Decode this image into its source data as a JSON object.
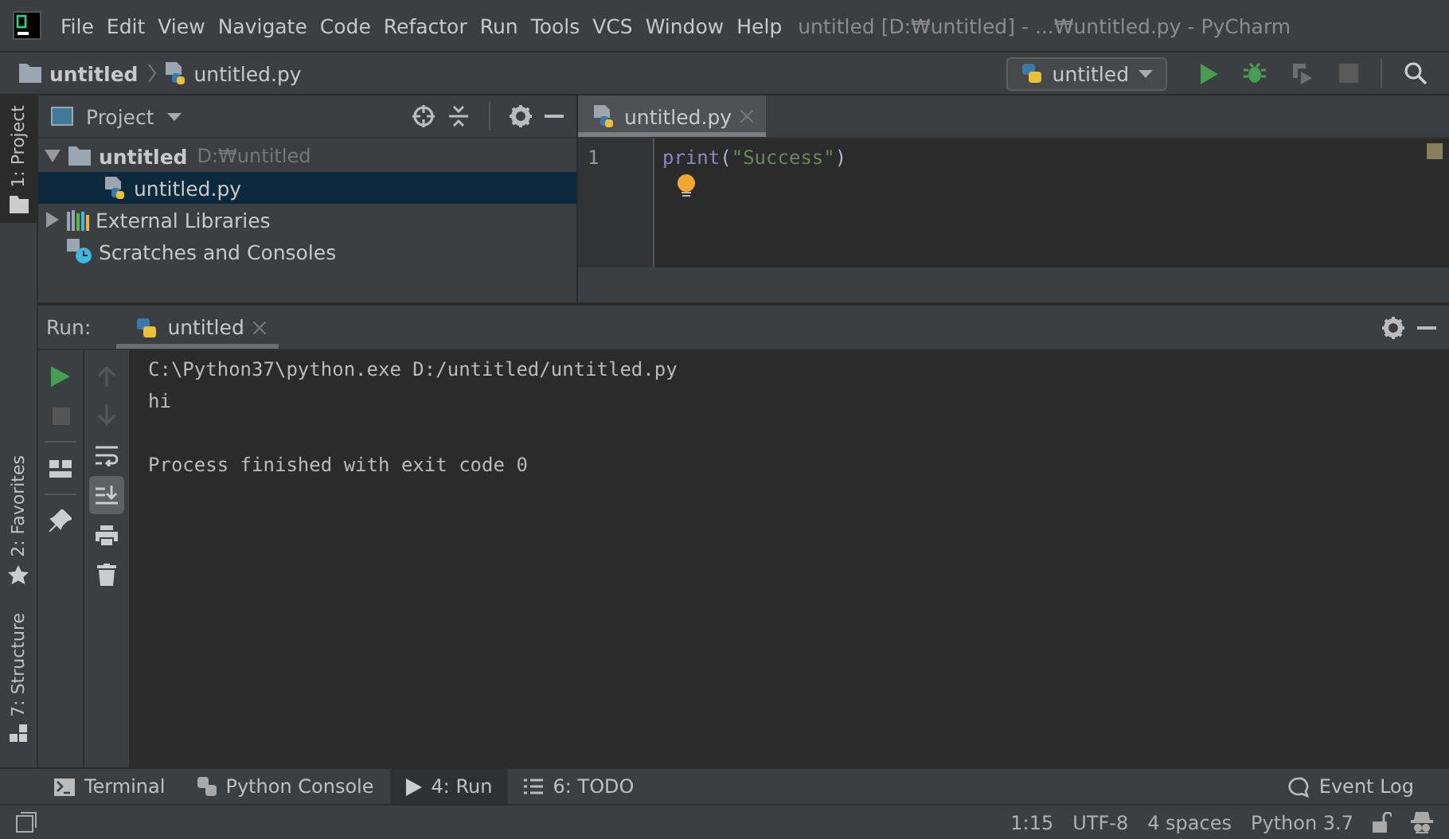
{
  "title_bar": {
    "menu": [
      "File",
      "Edit",
      "View",
      "Navigate",
      "Code",
      "Refactor",
      "Run",
      "Tools",
      "VCS",
      "Window",
      "Help"
    ],
    "window_title": "untitled [D:₩untitled] - ...₩untitled.py - PyCharm"
  },
  "nav_bar": {
    "breadcrumbs": [
      {
        "label": "untitled",
        "kind": "folder"
      },
      {
        "label": "untitled.py",
        "kind": "python"
      }
    ],
    "run_config": "untitled"
  },
  "tool_stripe": [
    {
      "label": "1: Project",
      "kind": "project",
      "selected": true
    },
    {
      "label": "2: Favorites",
      "kind": "favorites",
      "selected": false
    },
    {
      "label": "7: Structure",
      "kind": "structure",
      "selected": false
    }
  ],
  "project_panel": {
    "title": "Project",
    "tree": [
      {
        "name": "untitled",
        "path": "D:₩untitled",
        "kind": "folder",
        "expanded": true,
        "selected": false,
        "children": [
          {
            "name": "untitled.py",
            "kind": "python",
            "selected": true
          }
        ]
      },
      {
        "name": "External Libraries",
        "kind": "libraries",
        "expanded": false,
        "selected": false
      },
      {
        "name": "Scratches and Consoles",
        "kind": "scratches",
        "selected": false
      }
    ]
  },
  "editor": {
    "tabs": [
      {
        "label": "untitled.py",
        "selected": true
      }
    ],
    "lines": [
      {
        "number": "1",
        "tokens": [
          {
            "text": "print",
            "kind": "function"
          },
          {
            "text": "(",
            "kind": "plain"
          },
          {
            "text": "\"Success\"",
            "kind": "string"
          },
          {
            "text": ")",
            "kind": "plain"
          }
        ]
      }
    ]
  },
  "run_panel": {
    "label": "Run:",
    "tabs": [
      {
        "label": "untitled",
        "selected": true
      }
    ],
    "left_toolbar": [
      {
        "kind": "rerun",
        "disabled": false
      },
      {
        "kind": "stop",
        "disabled": true
      },
      {
        "kind": "layout",
        "disabled": false
      },
      {
        "kind": "pin",
        "disabled": false
      }
    ],
    "right_toolbar": [
      {
        "kind": "up",
        "disabled": true,
        "on": false
      },
      {
        "kind": "down",
        "disabled": true,
        "on": false
      },
      {
        "kind": "wrap",
        "disabled": false,
        "on": false
      },
      {
        "kind": "scroll-end",
        "disabled": false,
        "on": true
      },
      {
        "kind": "print",
        "disabled": false,
        "on": false
      },
      {
        "kind": "clear",
        "disabled": false,
        "on": false
      }
    ],
    "output": [
      {
        "text": "C:\\Python37\\python.exe D:/untitled/untitled.py",
        "kind": "command"
      },
      {
        "text": "hi",
        "kind": "stdout"
      },
      {
        "text": "Process finished with exit code 0",
        "kind": "exit"
      }
    ]
  },
  "bottom_tabs": [
    {
      "label": "Terminal",
      "kind": "terminal",
      "selected": false
    },
    {
      "label": "Python Console",
      "kind": "python",
      "selected": false
    },
    {
      "label": "4: Run",
      "kind": "run",
      "selected": true
    },
    {
      "label": "6: TODO",
      "kind": "todo",
      "selected": false
    }
  ],
  "event_log": "Event Log",
  "status_bar": [
    "1:15",
    "UTF-8",
    "4 spaces",
    "Python 3.7"
  ]
}
